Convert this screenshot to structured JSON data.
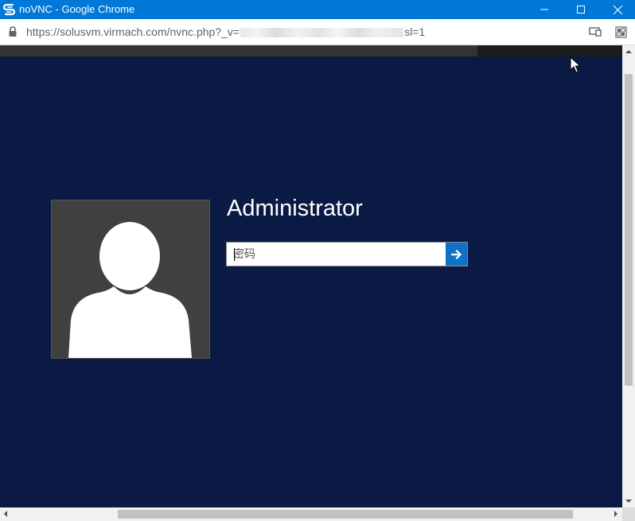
{
  "window": {
    "title": "noVNC - Google Chrome",
    "app_icon": "solusvm-logo-icon",
    "controls": [
      "minimize-icon",
      "maximize-icon",
      "close-icon"
    ]
  },
  "address_bar": {
    "url_prefix": "https://solusvm.virmach.com/nvnc.php?_v=",
    "url_suffix": "sl=1",
    "icons": [
      "lock-icon",
      "cast-icon",
      "extension-icon"
    ]
  },
  "login": {
    "username": "Administrator",
    "password_placeholder": "密码",
    "password_value": "",
    "submit_icon": "arrow-right-icon"
  },
  "colors": {
    "titlebar": "#0078d7",
    "login_background": "#0a1a45",
    "avatar_tile": "#404040",
    "submit_button": "#0f72c9"
  }
}
